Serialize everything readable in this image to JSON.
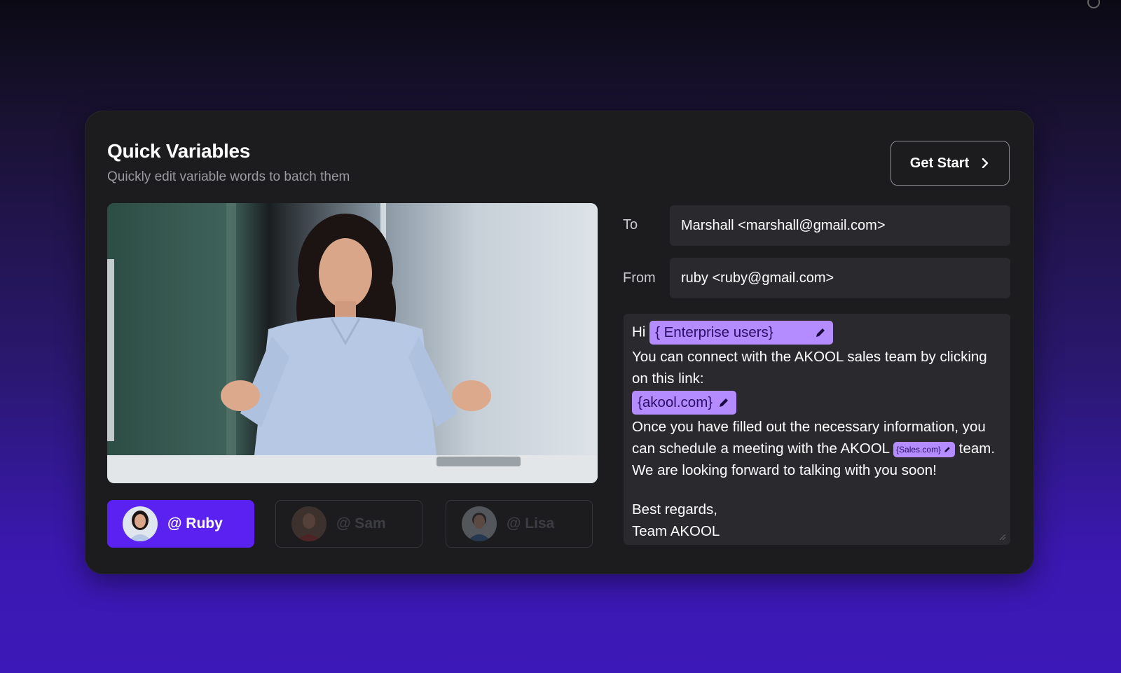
{
  "header": {
    "title": "Quick Variables",
    "subtitle": "Quickly edit variable words to batch them",
    "cta_label": "Get Start"
  },
  "avatars": [
    {
      "label": "@ Ruby",
      "active": true
    },
    {
      "label": "@ Sam",
      "active": false
    },
    {
      "label": "@ Lisa",
      "active": false
    }
  ],
  "email": {
    "to_label": "To",
    "to_value": "Marshall <marshall@gmail.com>",
    "from_label": "From",
    "from_value": "ruby <ruby@gmail.com>",
    "greeting": "Hi",
    "var_recipient": "{ Enterprise users}",
    "line1": "You can connect with the AKOOL sales team by clicking on this link:",
    "var_link": "{akool.com}",
    "line2a": "Once you have filled out the necessary information, you can schedule a meeting with the AKOOL",
    "var_team": "{Sales.com}",
    "line2b": "team. We are looking forward to talking with you soon!",
    "signoff": "Best regards,",
    "signature": "Team AKOOL"
  },
  "colors": {
    "accent": "#5b21f0",
    "chip": "#b48cff",
    "card": "#1c1c1f",
    "field": "#2a2a2e"
  }
}
